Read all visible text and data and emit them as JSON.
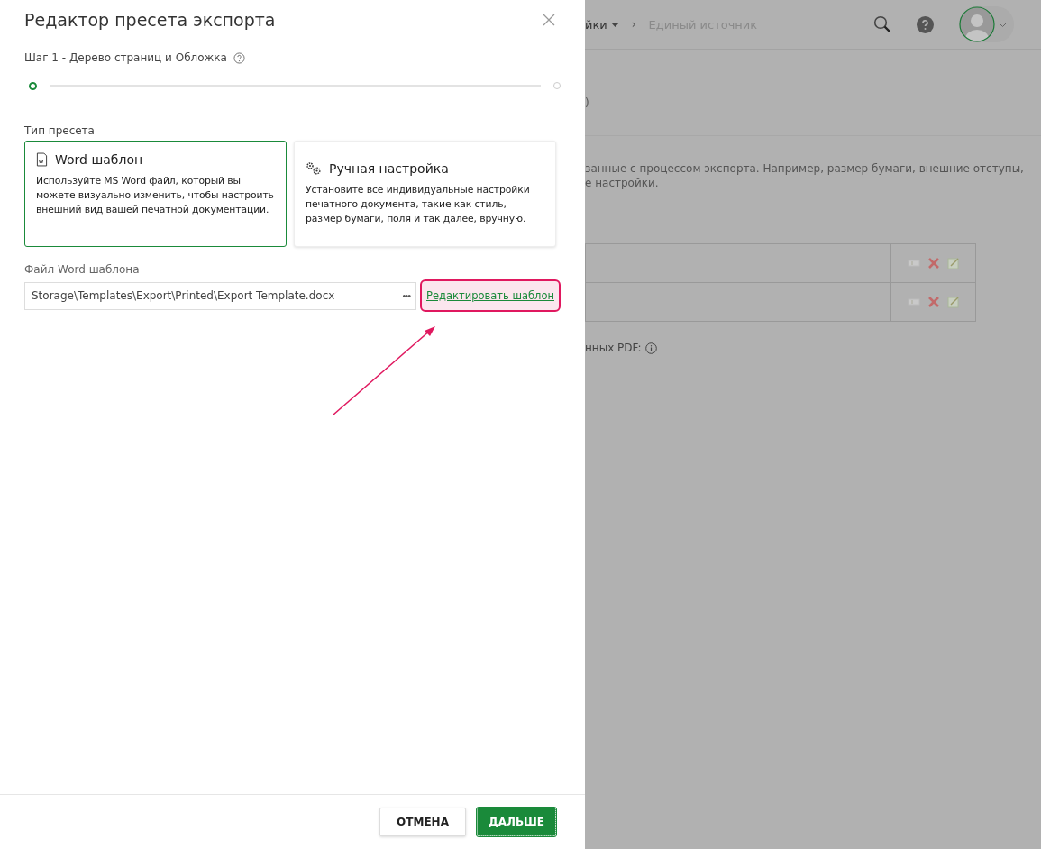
{
  "dialog": {
    "title": "Редактор пресета экспорта",
    "step_label": "Шаг 1 - Дерево страниц и Обложка",
    "steps": [
      {
        "selected": true
      },
      {
        "selected": false
      }
    ],
    "preset_type_label": "Тип пресета",
    "preset_types": [
      {
        "kind": "word",
        "title": "Word шаблон",
        "description": "Используйте MS Word файл, который вы можете визуально изменить, чтобы настроить внешний вид вашей печатной документации.",
        "selected": true
      },
      {
        "kind": "manual",
        "title": "Ручная настройка",
        "description": "Установите все индивидуальные настройки печатного документа, такие как стиль, размер бумаги, поля и так далее, вручную.",
        "selected": false
      }
    ],
    "file_label": "Файл Word шаблона",
    "file_value": "Storage\\Templates\\Export\\Printed\\Export Template.docx",
    "browse": "•••",
    "edit_link": {
      "text": "Редактировать шаблон",
      "highlighted": true
    },
    "buttons": [
      {
        "kind": "secondary",
        "label": "ОТМЕНА"
      },
      {
        "kind": "primary",
        "label": "ДАЛЬШЕ"
      }
    ]
  },
  "background": {
    "breadcrumb": [
      {
        "text": "йки",
        "dropdown": true
      },
      {
        "text": "Единый источник",
        "dropdown": false
      }
    ],
    "breadcrumb_separator": "›",
    "tab_fragment": ")",
    "description_lines": [
      "занные с процессом экспорта. Например, размер бумаги, внешние отступы,",
      "е настройки."
    ],
    "table_rows": [
      {
        "kind": "preset"
      },
      {
        "kind": "preset"
      }
    ],
    "pdf_label": "нных PDF:"
  }
}
